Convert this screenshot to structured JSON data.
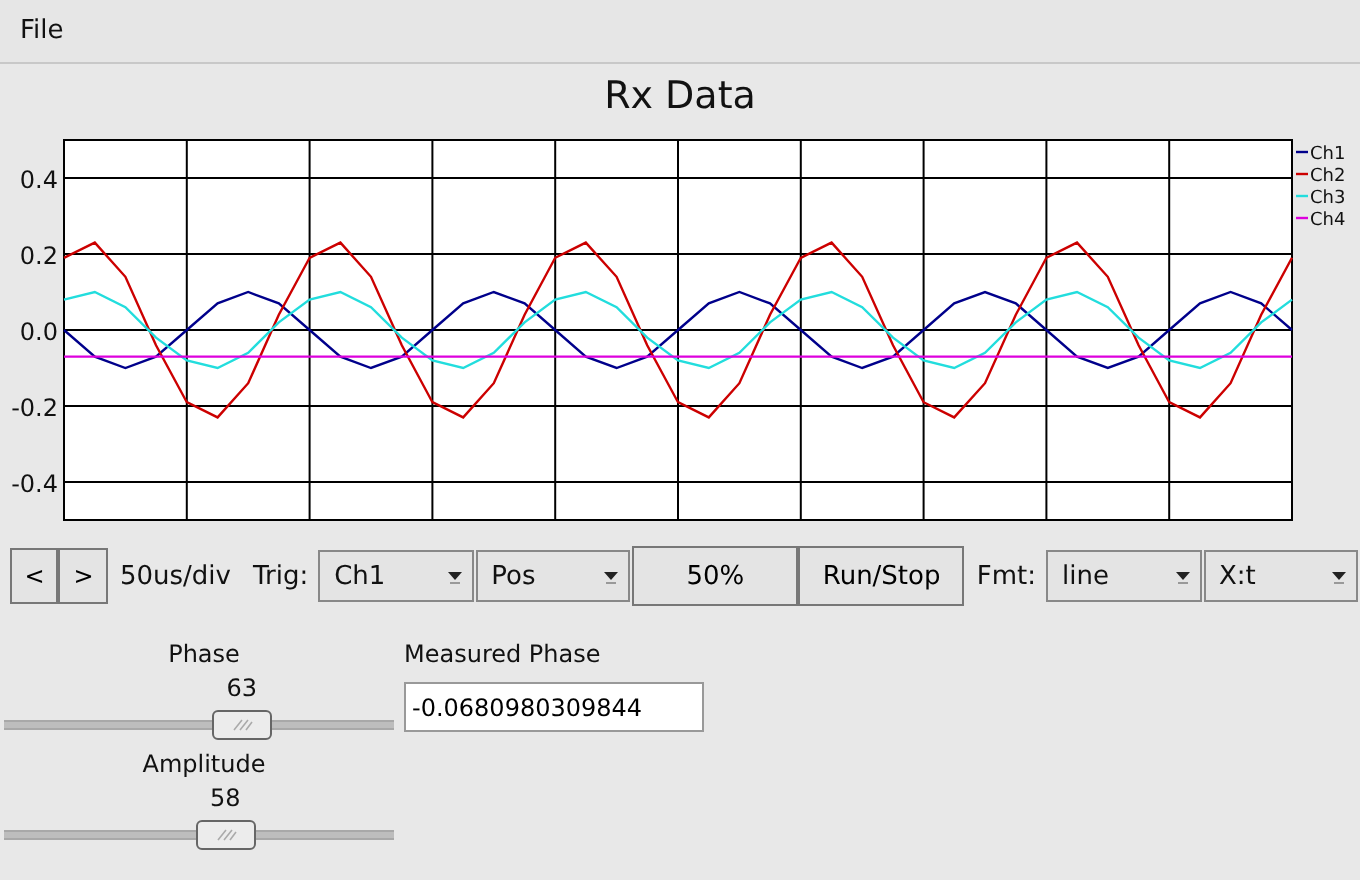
{
  "menu": [
    {
      "label": "File"
    }
  ],
  "chart": {
    "title": "Rx Data",
    "chart_data": {
      "type": "line",
      "grid": true,
      "legend": "right",
      "ylim": [
        -0.5,
        0.5
      ],
      "yticks": [
        {
          "value": 0.4,
          "label": "0.4"
        },
        {
          "value": 0.2,
          "label": "0.2"
        },
        {
          "value": 0,
          "label": "0.0"
        },
        {
          "value": -0.2,
          "label": "-0.2"
        },
        {
          "value": -0.4,
          "label": "-0.4"
        }
      ],
      "categories": [
        null,
        null,
        null,
        null,
        null,
        null,
        null,
        null,
        null,
        null,
        null,
        null,
        null,
        null,
        null,
        null,
        null,
        null,
        null,
        null,
        null,
        null,
        null,
        null,
        null,
        null,
        null,
        null,
        null,
        null,
        null,
        null,
        null,
        null,
        null,
        null,
        null,
        null,
        null,
        null,
        null
      ],
      "series": [
        {
          "name": "Ch1",
          "color": "#00008b",
          "values": [
            0,
            -0.07,
            -0.1,
            -0.07,
            0,
            0.07,
            0.1,
            0.07,
            0,
            -0.07,
            -0.1,
            -0.07,
            0,
            0.07,
            0.1,
            0.07,
            0,
            -0.07,
            -0.1,
            -0.07,
            0,
            0.07,
            0.1,
            0.07,
            0,
            -0.07,
            -0.1,
            -0.07,
            0,
            0.07,
            0.1,
            0.07,
            0,
            -0.07,
            -0.1,
            -0.07,
            0,
            0.07,
            0.1,
            0.07,
            0
          ]
        },
        {
          "name": "Ch2",
          "color": "#cc0000",
          "values": [
            0.19,
            0.23,
            0.14,
            -0.04,
            -0.19,
            -0.23,
            -0.14,
            0.04,
            0.19,
            0.23,
            0.14,
            -0.04,
            -0.19,
            -0.23,
            -0.14,
            0.04,
            0.19,
            0.23,
            0.14,
            -0.04,
            -0.19,
            -0.23,
            -0.14,
            0.04,
            0.19,
            0.23,
            0.14,
            -0.04,
            -0.19,
            -0.23,
            -0.14,
            0.04,
            0.19,
            0.23,
            0.14,
            -0.04,
            -0.19,
            -0.23,
            -0.14,
            0.04,
            0.19
          ]
        },
        {
          "name": "Ch3",
          "color": "#22dddd",
          "values": [
            0.08,
            0.1,
            0.06,
            -0.02,
            -0.08,
            -0.1,
            -0.06,
            0.02,
            0.08,
            0.1,
            0.06,
            -0.02,
            -0.08,
            -0.1,
            -0.06,
            0.02,
            0.08,
            0.1,
            0.06,
            -0.02,
            -0.08,
            -0.1,
            -0.06,
            0.02,
            0.08,
            0.1,
            0.06,
            -0.02,
            -0.08,
            -0.1,
            -0.06,
            0.02,
            0.08,
            0.1,
            0.06,
            -0.02,
            -0.08,
            -0.1,
            -0.06,
            0.02,
            0.08
          ]
        },
        {
          "name": "Ch4",
          "color": "#dd00dd",
          "values": [
            -0.07,
            -0.07,
            -0.07,
            -0.07,
            -0.07,
            -0.07,
            -0.07,
            -0.07,
            -0.07,
            -0.07,
            -0.07,
            -0.07,
            -0.07,
            -0.07,
            -0.07,
            -0.07,
            -0.07,
            -0.07,
            -0.07,
            -0.07,
            -0.07,
            -0.07,
            -0.07,
            -0.07,
            -0.07,
            -0.07,
            -0.07,
            -0.07,
            -0.07,
            -0.07,
            -0.07,
            -0.07,
            -0.07,
            -0.07,
            -0.07,
            -0.07,
            -0.07,
            -0.07,
            -0.07,
            -0.07,
            -0.07
          ]
        }
      ]
    }
  },
  "controls": [
    {
      "kind": "nav_button",
      "label": "<"
    },
    {
      "kind": "nav_button",
      "label": ">"
    },
    {
      "kind": "label",
      "text": "50us/div"
    },
    {
      "kind": "label",
      "text": "Trig:"
    },
    {
      "kind": "dropdown",
      "value": "Ch1"
    },
    {
      "kind": "dropdown",
      "value": "Pos"
    },
    {
      "kind": "button",
      "label": "50%"
    },
    {
      "kind": "button",
      "label": "Run/Stop"
    },
    {
      "kind": "label",
      "text": "Fmt:"
    },
    {
      "kind": "dropdown",
      "value": "line"
    },
    {
      "kind": "dropdown",
      "value": "X:t"
    }
  ],
  "sliders": [
    {
      "label": "Phase",
      "reading": "63",
      "level": 0.63
    },
    {
      "label": "Amplitude",
      "reading": "58",
      "level": 0.58
    }
  ],
  "measured": {
    "label": "Measured Phase",
    "value": "-0.0680980309844"
  }
}
